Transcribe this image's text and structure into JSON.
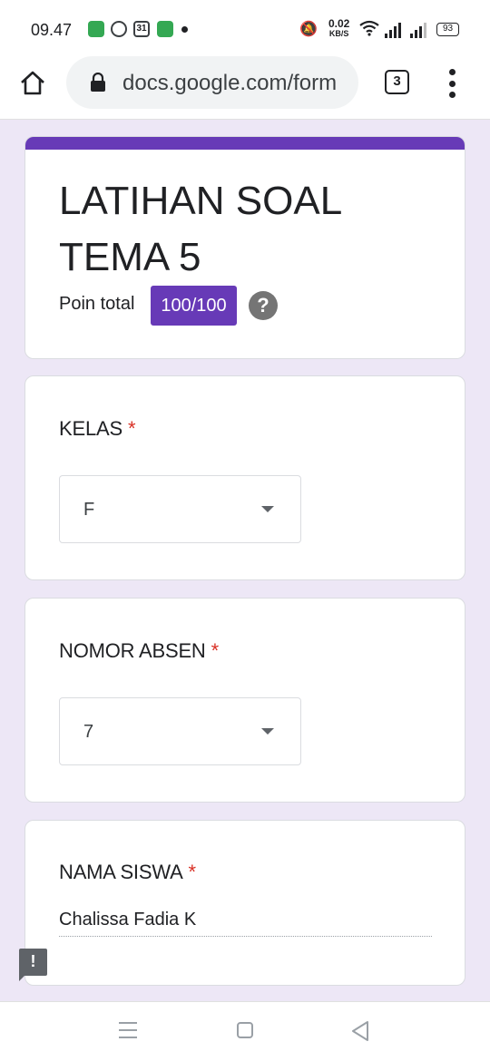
{
  "status_bar": {
    "time": "09.47",
    "calendar_day": "31",
    "net_speed_value": "0.02",
    "net_speed_unit": "KB/S",
    "battery": "93",
    "icons": [
      "messenger-icon",
      "chat-icon",
      "calendar-icon",
      "app-icon",
      "mute-icon",
      "wifi-icon",
      "signal-icon",
      "battery-icon"
    ]
  },
  "browser": {
    "url": "docs.google.com/form",
    "tab_count": "3"
  },
  "form": {
    "title": "LATIHAN SOAL TEMA 5",
    "points_label": "Poin total",
    "points_value": "100/100",
    "accent_color": "#673ab7",
    "required_mark": "*",
    "questions": [
      {
        "label": "KELAS",
        "type": "dropdown",
        "value": "F"
      },
      {
        "label": "NOMOR ABSEN",
        "type": "dropdown",
        "value": "7"
      },
      {
        "label": "NAMA SISWA",
        "type": "short_answer",
        "value": "Chalissa Fadia K"
      }
    ]
  },
  "colors": {
    "background": "#ede7f6",
    "required": "#d93025"
  }
}
